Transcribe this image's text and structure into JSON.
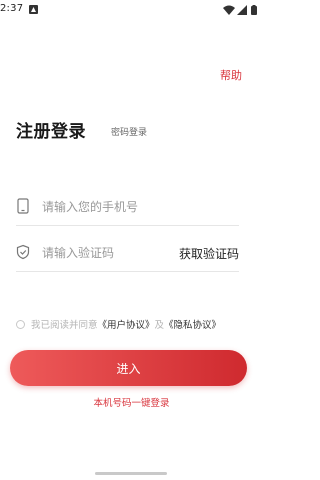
{
  "status_bar": {
    "time": "2:37",
    "icons": [
      "notification-a-icon",
      "wifi-icon",
      "signal-icon",
      "battery-icon"
    ]
  },
  "header": {
    "help_label": "帮助"
  },
  "title": {
    "main": "注册登录",
    "password_login": "密码登录"
  },
  "form": {
    "phone_placeholder": "请输入您的手机号",
    "code_placeholder": "请输入验证码",
    "get_code_label": "获取验证码"
  },
  "agreement": {
    "prefix": "我已阅读并同意",
    "user_agreement": "《用户协议》",
    "and": "及",
    "privacy_agreement": "《隐私协议》"
  },
  "actions": {
    "login_label": "进入",
    "one_click_label": "本机号码一键登录"
  },
  "colors": {
    "accent": "#d9363e",
    "button_start": "#ee5a5a",
    "button_end": "#cf2a2f"
  }
}
